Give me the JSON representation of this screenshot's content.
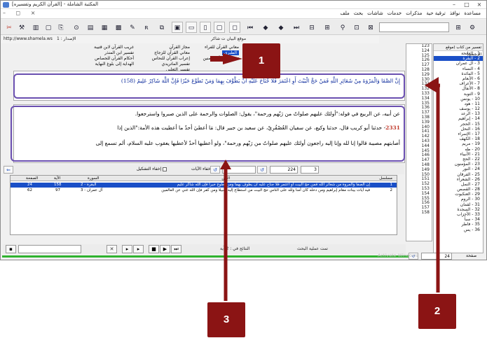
{
  "window": {
    "title": "المكتبة الشاملة - [القرآن الكريم وتفسيره]",
    "controls": [
      "–",
      "□",
      "×"
    ]
  },
  "menu": {
    "items": [
      "ملف",
      "بحث",
      "شاشات",
      "خدمات",
      "مذكرات",
      "ترقية حية",
      "نوافذ",
      "مساعدة"
    ]
  },
  "toolbar": {
    "icons": [
      "close-book-icon",
      "library-icon",
      "first-icon",
      "prev-icon",
      "next-icon",
      "last-icon",
      "search-icon",
      "binoculars-icon"
    ]
  },
  "subbar": {
    "url": "http://www.shamela.ws",
    "version": "الإصدار : 1",
    "tab_label": "موقع البيان ت شاكر"
  },
  "tafsir_list": {
    "col1": [
      "معاني القرآن للفراء",
      "الطبري",
      "تفسير ابن أبي زمنين"
    ],
    "col2": [
      "مجاز القرآن",
      "معاني القرآن للزجاج",
      "إعراب القرآن للنحاس"
    ],
    "col3": [
      "غريب القرآن لابن قتيبة",
      "تفسير ابن المنذر",
      "أحكام القرآن للجصاص"
    ],
    "col2b": [
      "تفسير الماتريدي",
      "تفسير الثعلبي"
    ],
    "col3b": [
      "الهداية إلى بلوغ النهاية"
    ],
    "selected": "الطبري"
  },
  "verse": {
    "text": "إِنَّ الصَّفَا وَالْمَرْوَةَ مِنْ شَعَائِرِ اللَّهِ فَمَنْ حَجَّ الْبَيْتَ أَوِ اعْتَمَرَ فَلَا جُنَاحَ عَلَيْهِ أَنْ يَطَّوَّفَ بِهِمَا وَمَنْ تَطَوَّعَ خَيْرًا فَإِنَّ اللَّهَ شَاكِرٌ عَلِيمٌ (158)"
  },
  "commentary": {
    "line1": "عن أبيه، عن الربيع في قوله:\"أولئك عليهم صلواتٌ من رَبّهم ورحمة\"، يقول: الصلوات والرحمة على الذين صبروا واسترجعوا.",
    "num": "2331",
    "line2": "- حدثنا أبو كريب قال، حدثنا وكيع، عن سفيان العُصْفُرِيّ، عن سعيد بن جبير قال: مَا أعطيَ أحدٌ ما أعطيت هذه الأمة:\"الذين إذا",
    "line3": "أصابتهم مصيبة قالوا إنا لله وإنا إليه راجعون أولئك عليهم صلواتٌ من رَبّهم ورحمة\"، ولو أعطيها أحدٌ لأعطيها يعقوب عليه السلام، ألم تسمع إلى"
  },
  "controls": {
    "hide_diacritics": "إخفاء التشكيل",
    "hide_verses": "إخفاء الآيات",
    "page_value": "224",
    "part_value": "3"
  },
  "results": {
    "headers": [
      "مسلسل",
      "النص",
      "السورة",
      "الآية",
      "الصفحة"
    ],
    "rows": [
      {
        "serial": "1",
        "text": "إن الصفا والمروة من شعائر الله فمن حج البيت أو اعتمر فلا جناح عليه أن يطوف بهما ومن تطوع خيرا فإن الله شاكر عليم",
        "sura": "2 - البقرة",
        "aya": "158",
        "page": "24",
        "selected": true
      },
      {
        "serial": "2",
        "text": "فيه آيات بينات مقام إبراهيم ومن دخله كان آمنا ولله على الناس حج البيت من استطاع إليه سبيلا ومن كفر فإن الله غني عن العالمين",
        "sura": "3 - آل عمران",
        "aya": "97",
        "page": "62",
        "selected": false
      }
    ]
  },
  "bottom": {
    "results_label": "النتائج في : 2 آية",
    "status_label": "تمت عملية البحث",
    "page_label": "صفحة",
    "page_value": "24"
  },
  "pages": [
    "123",
    "124",
    "125",
    "126",
    "127",
    "128",
    "129",
    "130",
    "131",
    "132",
    "133",
    "134",
    "135",
    "136",
    "137",
    "138",
    "139",
    "140",
    "141",
    "142",
    "143",
    "144",
    "145",
    "146",
    "147",
    "148",
    "149",
    "150",
    "151",
    "152",
    "153",
    "154",
    "155",
    "156",
    "157",
    "158"
  ],
  "suras": {
    "header": "تفسير من كتاب (موقع الرسمي)",
    "items": [
      "1 - الفاتحة",
      "2 - البقرة",
      "3 - آل عمران",
      "4 - النساء",
      "5 - المائدة",
      "6 - الأنعام",
      "7 - الأعراف",
      "8 - الأنفال",
      "9 - التوبة",
      "10 - يونس",
      "11 - هود",
      "12 - يوسف",
      "13 - الرعد",
      "14 - إبراهيم",
      "15 - الحجر",
      "16 - النحل",
      "17 - الإسراء",
      "18 - الكهف",
      "19 - مريم",
      "20 - طه",
      "21 - الأنبياء",
      "22 - الحج",
      "23 - المؤمنون",
      "24 - النور",
      "25 - الفرقان",
      "26 - الشعراء",
      "27 - النمل",
      "28 - القصص",
      "29 - العنكبوت",
      "30 - الروم",
      "31 - لقمان",
      "32 - السجدة",
      "33 - الأحزاب",
      "34 - سبأ",
      "35 - فاطر",
      "36 - يس"
    ],
    "selected": "2 - البقرة"
  },
  "watermark": "Activate Windows",
  "annotations": {
    "badge1": "1",
    "badge2": "2",
    "badge3": "3",
    "color": "#8b1414",
    "frame_color": "#6a4fb0"
  }
}
